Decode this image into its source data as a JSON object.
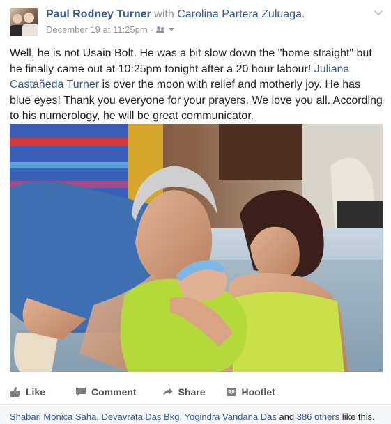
{
  "post": {
    "author": "Paul Rodney Turner",
    "with_word": "with",
    "tagged_person": "Carolina Partera Zuluaga.",
    "timestamp": "December 19 at 11:25pm",
    "meta_separator": "·",
    "audience_icon": "friends-icon",
    "menu_icon": "chevron-down-icon",
    "text_part1": "Well, he is not Usain Bolt. He was a bit slow down the \"home straight\" but he finally came out at 10:25pm tonight after a 20 hour labour! ",
    "text_mention": "Juliana Castañeda Turner",
    "text_part2": " is over the moon with relief and motherly joy. He has blue eyes! Thank you everyone for your prayers. We love you all. According to his numerology, he will be great communicator."
  },
  "actions": {
    "like_label": "Like",
    "comment_label": "Comment",
    "share_label": "Share",
    "hootlet_label": "Hootlet"
  },
  "likes": {
    "liker1": "Shabari Monica Saha",
    "sep1": ", ",
    "liker2": "Devavrata Das Bkg",
    "sep2": ", ",
    "liker3": "Yogindra Vandana Das",
    "and_word": " and ",
    "others": "386 others",
    "suffix": " like this."
  },
  "colors": {
    "link": "#365899",
    "meta_grey": "#90949c",
    "action_grey": "#4b4f56"
  }
}
